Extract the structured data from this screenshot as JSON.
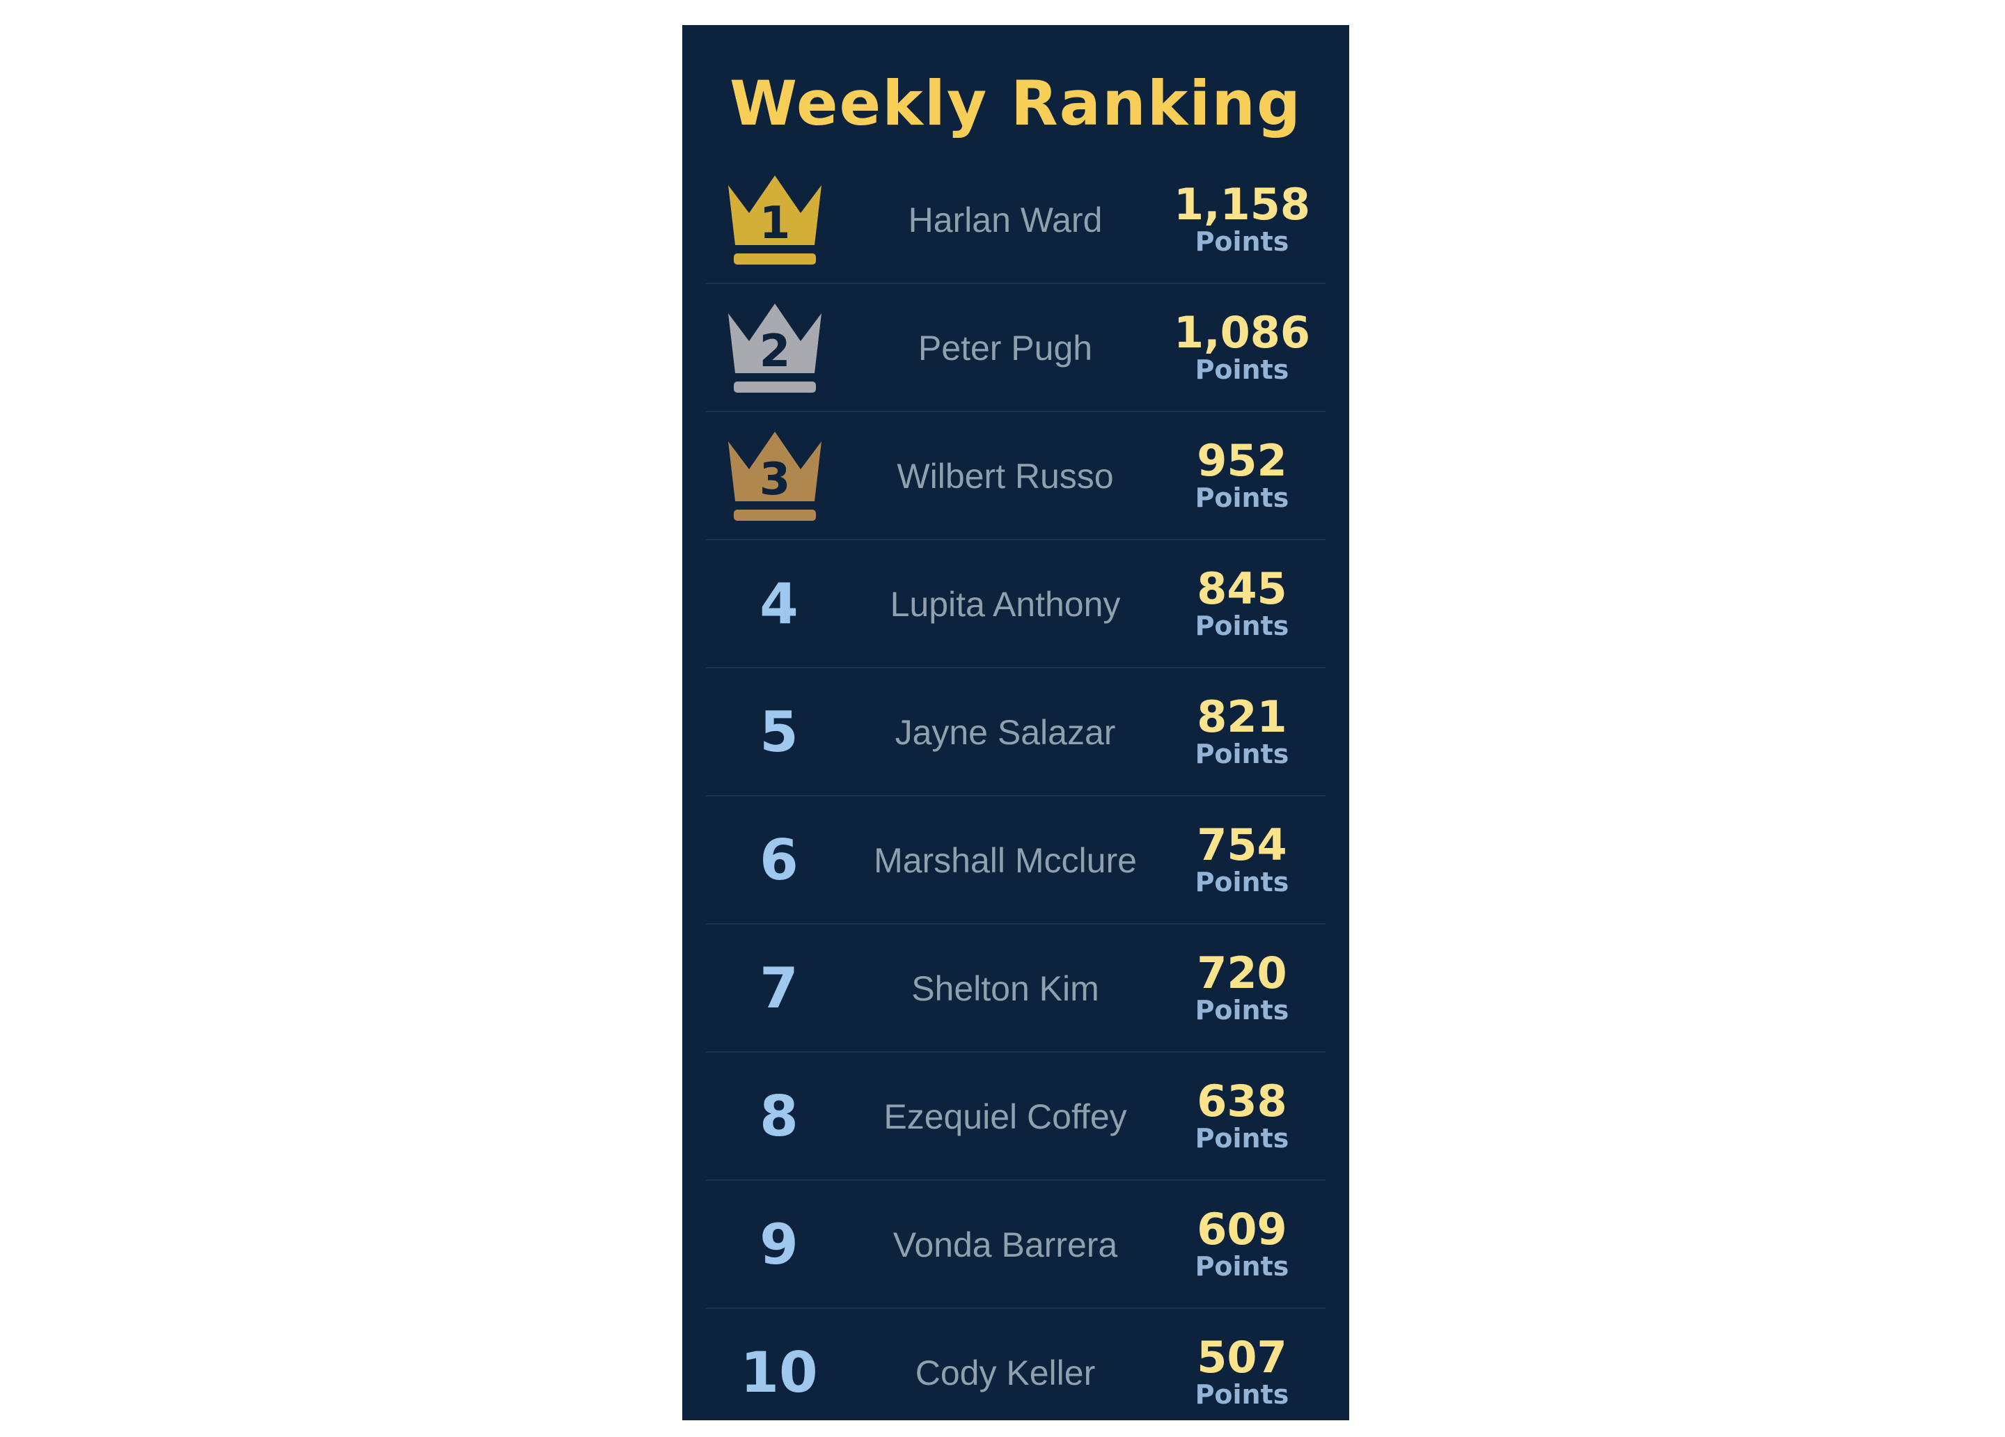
{
  "leaderboard": {
    "title": "Weekly Ranking",
    "points_label": "Points",
    "entries": [
      {
        "rank": "1",
        "name": "Harlan Ward",
        "score": "1,158",
        "crown_color": "#d4af37"
      },
      {
        "rank": "2",
        "name": "Peter Pugh",
        "score": "1,086",
        "crown_color": "#a9a9b0"
      },
      {
        "rank": "3",
        "name": "Wilbert Russo",
        "score": "952",
        "crown_color": "#b0884f"
      },
      {
        "rank": "4",
        "name": "Lupita Anthony",
        "score": "845"
      },
      {
        "rank": "5",
        "name": "Jayne Salazar",
        "score": "821"
      },
      {
        "rank": "6",
        "name": "Marshall Mcclure",
        "score": "754"
      },
      {
        "rank": "7",
        "name": "Shelton Kim",
        "score": "720"
      },
      {
        "rank": "8",
        "name": "Ezequiel Coffey",
        "score": "638"
      },
      {
        "rank": "9",
        "name": "Vonda Barrera",
        "score": "609"
      },
      {
        "rank": "10",
        "name": "Cody Keller",
        "score": "507"
      }
    ]
  },
  "colors": {
    "panel_background": "#0c223d",
    "title": "#f7cf58",
    "score": "#fbe38b",
    "points_label": "#93b4d6",
    "rank_number": "#9ec8ee",
    "name": "#8fa1ad",
    "crown_digit": "#0c223d"
  }
}
